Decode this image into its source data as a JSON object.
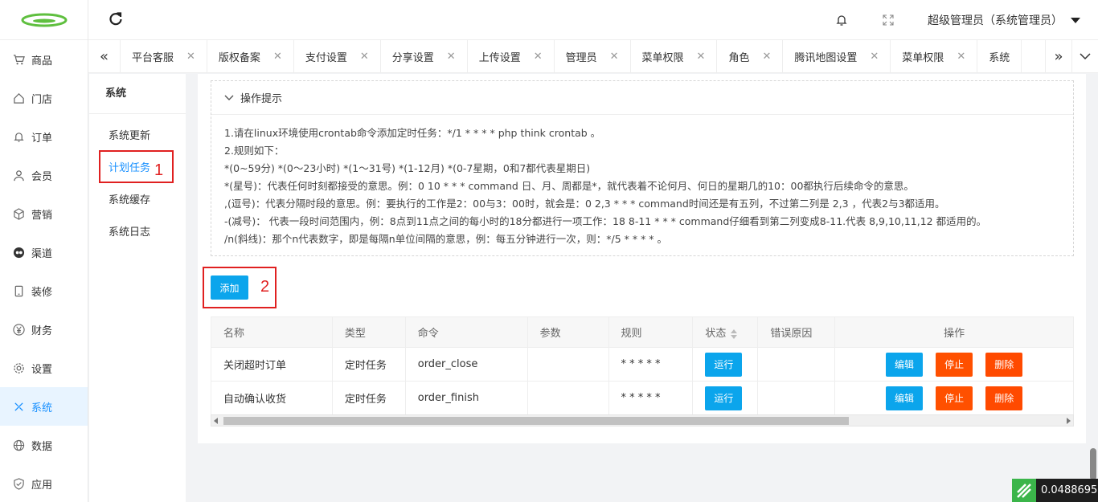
{
  "sidebar": {
    "items": [
      {
        "label": "商品",
        "icon": "cart-icon"
      },
      {
        "label": "门店",
        "icon": "home-icon"
      },
      {
        "label": "订单",
        "icon": "bell-icon"
      },
      {
        "label": "会员",
        "icon": "user-icon"
      },
      {
        "label": "营销",
        "icon": "cube-icon"
      },
      {
        "label": "渠道",
        "icon": "channel-icon"
      },
      {
        "label": "装修",
        "icon": "phone-icon"
      },
      {
        "label": "财务",
        "icon": "yen-icon"
      },
      {
        "label": "设置",
        "icon": "gear-icon"
      },
      {
        "label": "系统",
        "icon": "tools-icon"
      },
      {
        "label": "数据",
        "icon": "globe-icon"
      },
      {
        "label": "应用",
        "icon": "shield-icon"
      }
    ],
    "active_index": 9
  },
  "header": {
    "user": "超级管理员（系统管理员）"
  },
  "tabs": [
    "平台客服",
    "版权备案",
    "支付设置",
    "分享设置",
    "上传设置",
    "管理员",
    "菜单权限",
    "角色",
    "腾讯地图设置",
    "菜单权限",
    "系统"
  ],
  "submenu": {
    "title": "系统",
    "items": [
      "系统更新",
      "计划任务",
      "系统缓存",
      "系统日志"
    ],
    "active_index": 1
  },
  "annotations": {
    "one": "1",
    "two": "2"
  },
  "tips": {
    "title": "操作提示",
    "lines": [
      "1.请在linux环境使用crontab命令添加定时任务：*/1 * * * * php think crontab 。",
      "2.规则如下：",
      "*(0~59分)  *(0～23小时)  *(1～31号)  *(1-12月)  *(0-7星期，0和7都代表星期日)",
      "*(星号)：代表任何时刻都接受的意思。例：0 10 * * * command 日、月、周都是*，就代表着不论何月、何日的星期几的10：00都执行后续命令的意思。",
      ",(逗号)：代表分隔时段的意思。例：要执行的工作是2：00与3：00时，就会是：0 2,3 * * * command时间还是有五列，不过第二列是 2,3 ，代表2与3都适用。",
      "-(减号)：  代表一段时间范围内，例：8点到11点之间的每小时的18分都进行一项工作：18 8-11 * * * command仔细看到第二列变成8-11.代表 8,9,10,11,12 都适用的。",
      "/n(斜线)：那个n代表数字，即是每隔n单位间隔的意思，例：每五分钟进行一次，则：*/5 * * * * 。"
    ]
  },
  "add_button": "添加",
  "table": {
    "columns": [
      "名称",
      "类型",
      "命令",
      "参数",
      "规则",
      "状态",
      "错误原因",
      "操作"
    ],
    "rows": [
      {
        "name": "关闭超时订单",
        "type": "定时任务",
        "command": "order_close",
        "params": "",
        "rule": "* * * * *",
        "status": "运行",
        "error": "",
        "edit": "编辑",
        "stop": "停止",
        "delete": "删除"
      },
      {
        "name": "自动确认收货",
        "type": "定时任务",
        "command": "order_finish",
        "params": "",
        "rule": "* * * * *",
        "status": "运行",
        "error": "",
        "edit": "编辑",
        "stop": "停止",
        "delete": "删除"
      }
    ]
  },
  "widget": {
    "value": "0.0488695"
  }
}
